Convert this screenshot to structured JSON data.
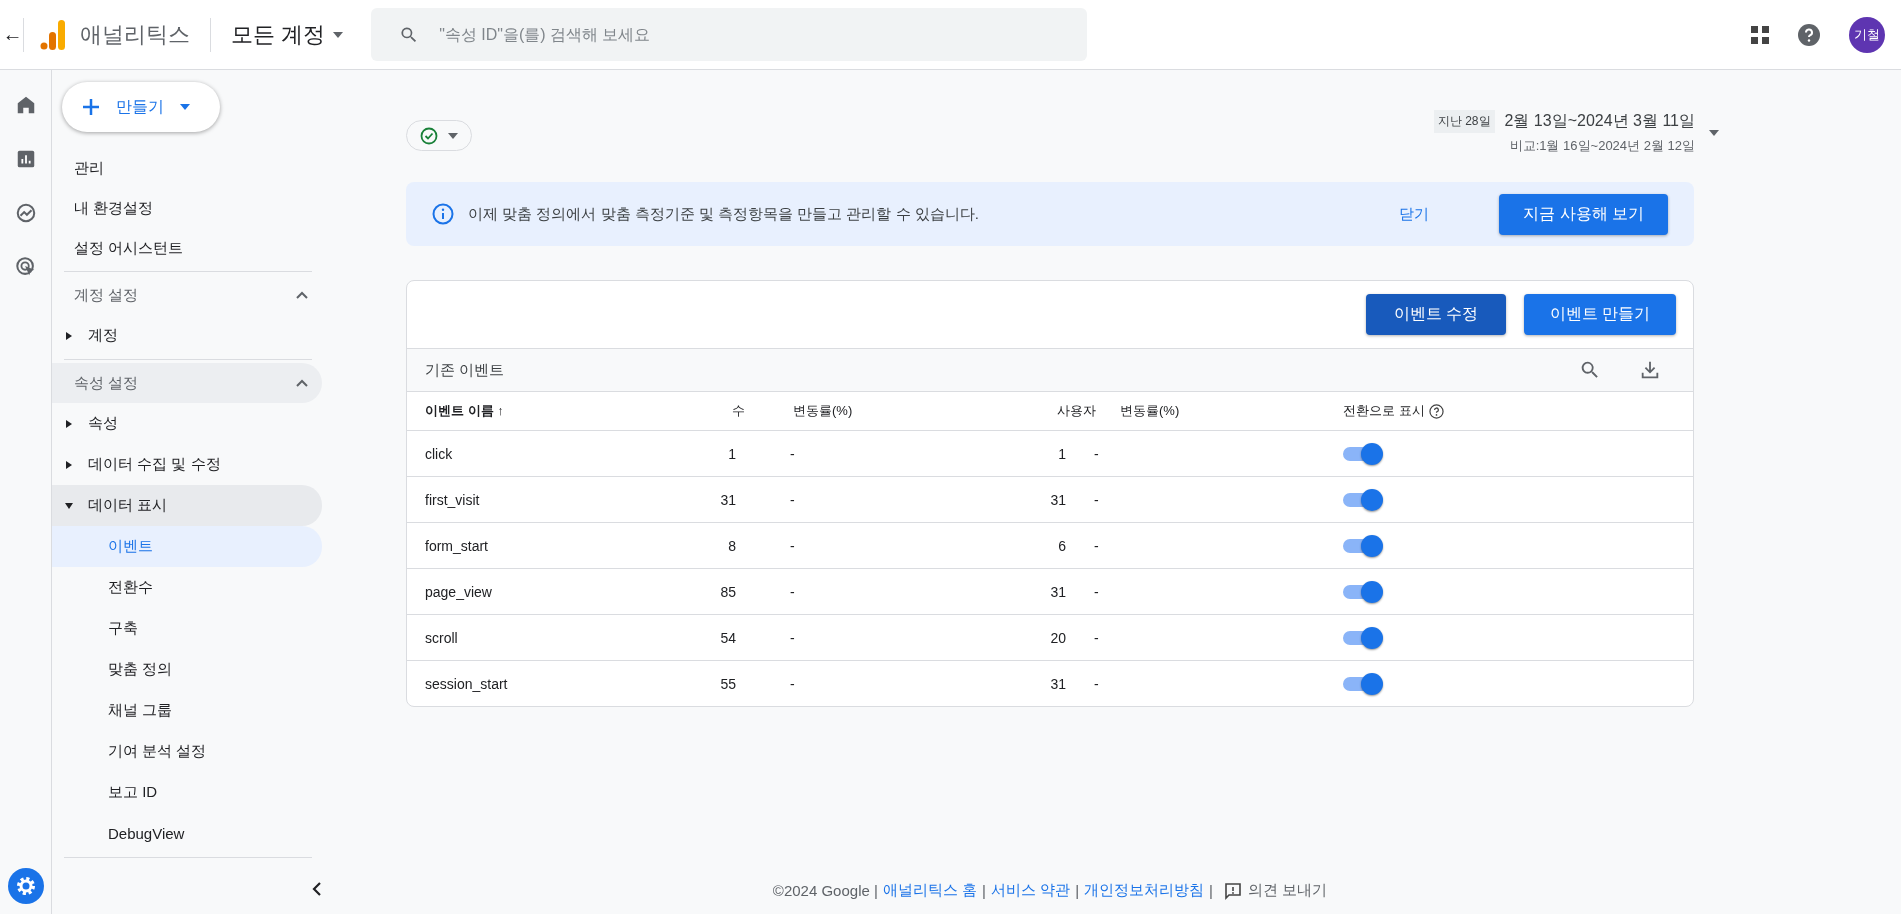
{
  "topbar": {
    "back": "←",
    "product": "애널리틱스",
    "account": "모든 계정",
    "search_placeholder": "\"속성 ID\"을(를) 검색해 보세요",
    "avatar": "기철"
  },
  "create_button": "만들기",
  "sidebar": {
    "top_items": [
      "관리",
      "내 환경설정",
      "설정 어시스턴트"
    ],
    "sections": [
      {
        "title": "계정 설정",
        "expanded": true,
        "highlighted": false,
        "items": [
          {
            "label": "계정",
            "expanded": false,
            "highlighted": false
          }
        ]
      },
      {
        "title": "속성 설정",
        "expanded": true,
        "highlighted": true,
        "items": [
          {
            "label": "속성",
            "expanded": false,
            "highlighted": false
          },
          {
            "label": "데이터 수집 및 수정",
            "expanded": false,
            "highlighted": false
          },
          {
            "label": "데이터 표시",
            "expanded": true,
            "highlighted": true,
            "children": [
              {
                "label": "이벤트",
                "selected": true
              },
              {
                "label": "전환수",
                "selected": false
              },
              {
                "label": "구축",
                "selected": false
              },
              {
                "label": "맞춤 정의",
                "selected": false
              },
              {
                "label": "채널 그룹",
                "selected": false
              },
              {
                "label": "기여 분석 설정",
                "selected": false
              },
              {
                "label": "보고 ID",
                "selected": false
              },
              {
                "label": "DebugView",
                "selected": false
              }
            ]
          }
        ]
      }
    ]
  },
  "date_range": {
    "preset": "지난 28일",
    "range": "2월 13일~2024년 3월 11일",
    "compare": "비교:1월 16일~2024년 2월 12일"
  },
  "banner": {
    "message": "이제 맞춤 정의에서 맞춤 측정기준 및 측정항목을 만들고 관리할 수 있습니다.",
    "dismiss": "닫기",
    "action": "지금 사용해 보기"
  },
  "events_card": {
    "buttons": [
      "이벤트 수정",
      "이벤트 만들기"
    ],
    "title": "기존 이벤트",
    "columns": [
      "이벤트 이름 ↑",
      "수",
      "변동률(%)",
      "사용자",
      "변동률(%)",
      "전환으로 표시"
    ],
    "rows": [
      {
        "name": "click",
        "count": "1",
        "count_change": "-",
        "users": "1",
        "users_change": "-",
        "conversion": true
      },
      {
        "name": "first_visit",
        "count": "31",
        "count_change": "-",
        "users": "31",
        "users_change": "-",
        "conversion": true
      },
      {
        "name": "form_start",
        "count": "8",
        "count_change": "-",
        "users": "6",
        "users_change": "-",
        "conversion": true
      },
      {
        "name": "page_view",
        "count": "85",
        "count_change": "-",
        "users": "31",
        "users_change": "-",
        "conversion": true
      },
      {
        "name": "scroll",
        "count": "54",
        "count_change": "-",
        "users": "20",
        "users_change": "-",
        "conversion": true
      },
      {
        "name": "session_start",
        "count": "55",
        "count_change": "-",
        "users": "31",
        "users_change": "-",
        "conversion": true
      }
    ]
  },
  "footer": {
    "copyright": "©2024 Google |",
    "links": [
      "애널리틱스 홈",
      "서비스 약관",
      "개인정보처리방침"
    ],
    "separator": "|",
    "feedback": "의견 보내기"
  }
}
